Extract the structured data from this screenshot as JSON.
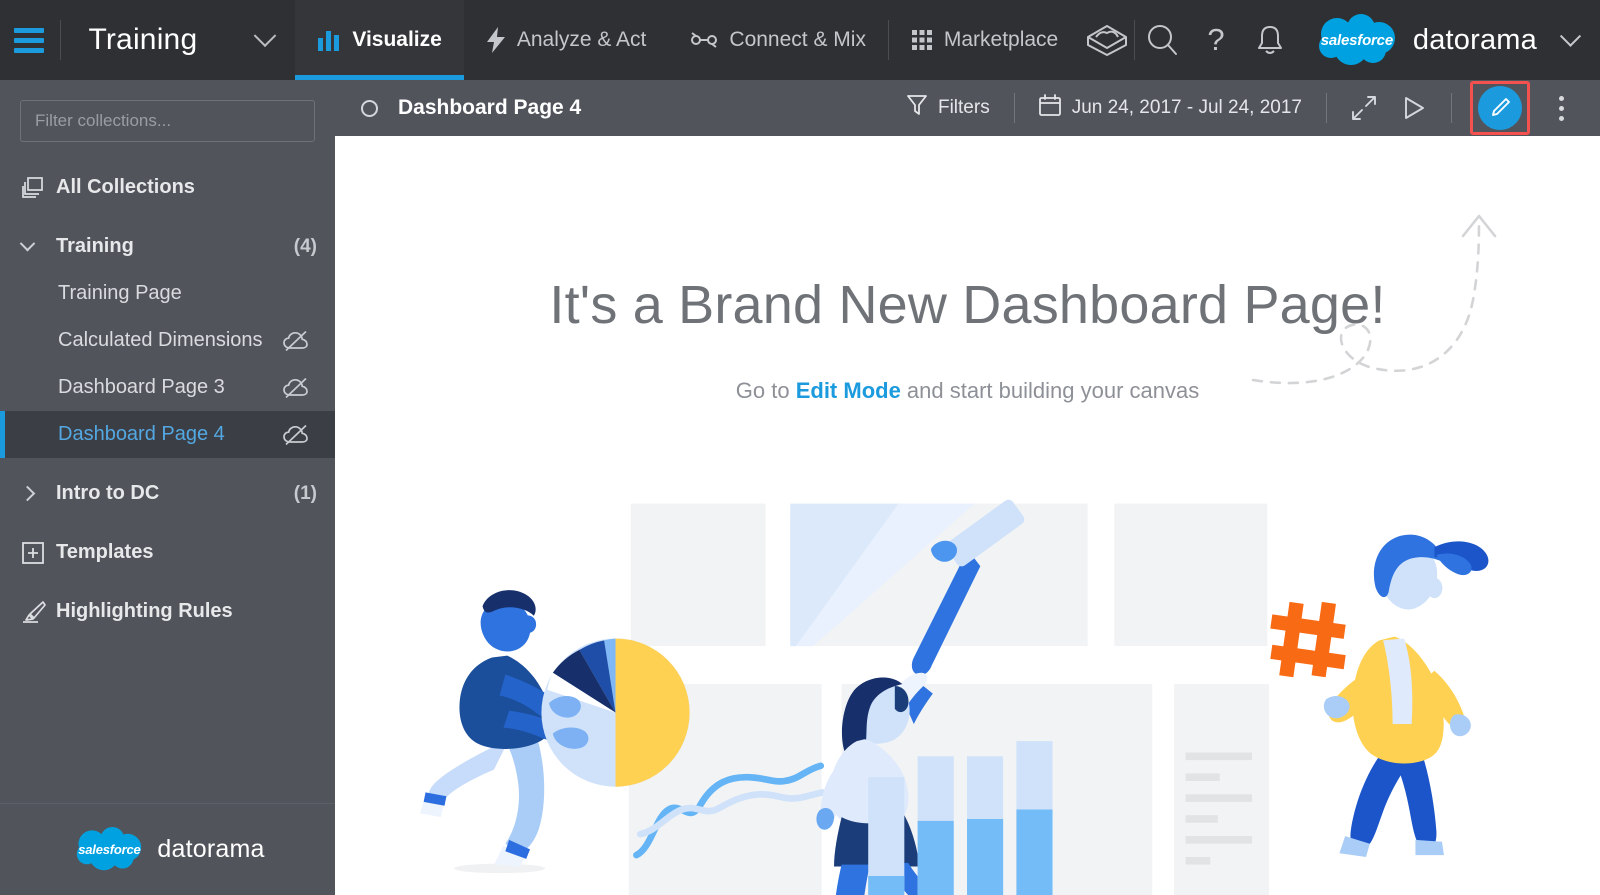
{
  "topnav": {
    "menu_icon": "hamburger-icon",
    "account": {
      "label": "Training",
      "chevron": "chevron-down-icon"
    },
    "tabs": [
      {
        "label": "Visualize",
        "icon": "bar-chart-icon",
        "active": true
      },
      {
        "label": "Analyze & Act",
        "icon": "lightning-icon",
        "active": false
      },
      {
        "label": "Connect & Mix",
        "icon": "connect-nodes-icon",
        "active": false
      },
      {
        "label": "Marketplace",
        "icon": "grid-dots-icon",
        "active": false
      }
    ],
    "actions": [
      {
        "name": "box-icon"
      },
      {
        "name": "search-icon"
      },
      {
        "name": "help-icon"
      },
      {
        "name": "notifications-bell-icon"
      }
    ],
    "brand": {
      "cloud_text": "salesforce",
      "word": "datorama",
      "chevron": "chevron-down-icon"
    }
  },
  "sidebar": {
    "filter": {
      "placeholder": "Filter collections...",
      "value": ""
    },
    "all_collections": {
      "label": "All Collections",
      "icon": "collections-stack-icon"
    },
    "collections": [
      {
        "label": "Training",
        "count": "(4)",
        "expanded": true,
        "chevron": "chevron-down-icon",
        "pages": [
          {
            "label": "Training Page",
            "icon": null,
            "selected": false
          },
          {
            "label": "Calculated Dimensions",
            "icon": "cloud-off-icon",
            "selected": false
          },
          {
            "label": "Dashboard Page 3",
            "icon": "cloud-off-icon",
            "selected": false
          },
          {
            "label": "Dashboard Page 4",
            "icon": "cloud-off-icon",
            "selected": true
          }
        ]
      },
      {
        "label": "Intro to DC",
        "count": "(1)",
        "expanded": false,
        "chevron": "chevron-right-icon",
        "pages": []
      }
    ],
    "templates": {
      "label": "Templates",
      "icon": "plus-box-icon"
    },
    "highlighting_rules": {
      "label": "Highlighting Rules",
      "icon": "highlighter-icon"
    },
    "footer": {
      "cloud_text": "salesforce",
      "word": "datorama"
    }
  },
  "dashboard_header": {
    "status_icon": "circle-outline-icon",
    "title": "Dashboard Page 4",
    "filters": {
      "label": "Filters",
      "icon": "funnel-icon"
    },
    "date_range": {
      "label": "Jun 24, 2017 - Jul 24, 2017",
      "icon": "calendar-icon"
    },
    "expand": {
      "name": "expand-icon"
    },
    "present": {
      "name": "play-presentation-icon"
    },
    "edit": {
      "name": "edit-pencil-button",
      "highlighted": true
    },
    "more": {
      "name": "kebab-menu-icon"
    }
  },
  "canvas": {
    "title": "It's a Brand New Dashboard Page!",
    "subtitle_before": "Go to ",
    "subtitle_link": "Edit Mode",
    "subtitle_after": " and start building your canvas",
    "decoration": "dashed-curved-arrow-icon",
    "illustration": "empty-dashboard-illustration"
  },
  "colors": {
    "accent_blue": "#1b9bde",
    "topnav_bg": "#2e3033",
    "sidebar_bg": "#52545c",
    "sidebar_selected_bg": "#3c3e45",
    "highlight_red": "#f4514f",
    "illus_dark_blue": "#1b3e7a",
    "illus_blue": "#1f62d8",
    "illus_light_blue": "#9ec6f5",
    "illus_pale_blue": "#d6e6fb",
    "illus_yellow": "#ffd152",
    "illus_orange": "#f96a14",
    "card_gray": "#f2f3f4"
  }
}
